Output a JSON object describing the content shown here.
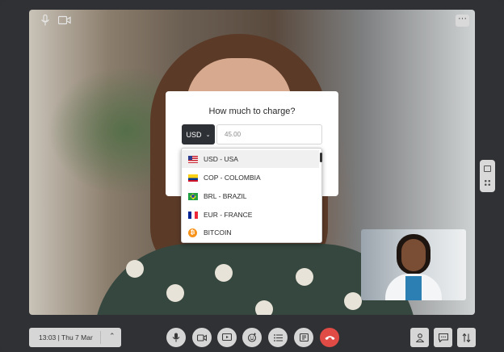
{
  "modal": {
    "title": "How much to charge?",
    "currency": "USD",
    "amount_value": "45.00"
  },
  "currency_options": [
    {
      "label": "USD - USA",
      "icon": "us-flag-icon",
      "selected": true
    },
    {
      "label": "COP - COLOMBIA",
      "icon": "colombia-flag-icon",
      "selected": false
    },
    {
      "label": "BRL - BRAZIL",
      "icon": "brazil-flag-icon",
      "selected": false
    },
    {
      "label": "EUR - FRANCE",
      "icon": "france-flag-icon",
      "selected": false
    },
    {
      "label": "BITCOIN",
      "icon": "bitcoin-icon",
      "selected": false
    }
  ],
  "bottom_bar": {
    "datetime": "13:03  |  Thu 7 Mar"
  },
  "colors": {
    "background": "#303134",
    "currency_button": "#2d3034",
    "hangup": "#e04b45",
    "control": "#d6d6d6"
  },
  "icons": {
    "top_left": [
      "microphone-icon",
      "camera-icon"
    ],
    "call_controls": [
      "microphone-icon",
      "camera-icon",
      "screen-share-icon",
      "reactions-icon",
      "list-icon",
      "whiteboard-icon",
      "hang-up-icon"
    ],
    "right_controls": [
      "participant-icon",
      "chat-icon",
      "settings-icon"
    ]
  }
}
